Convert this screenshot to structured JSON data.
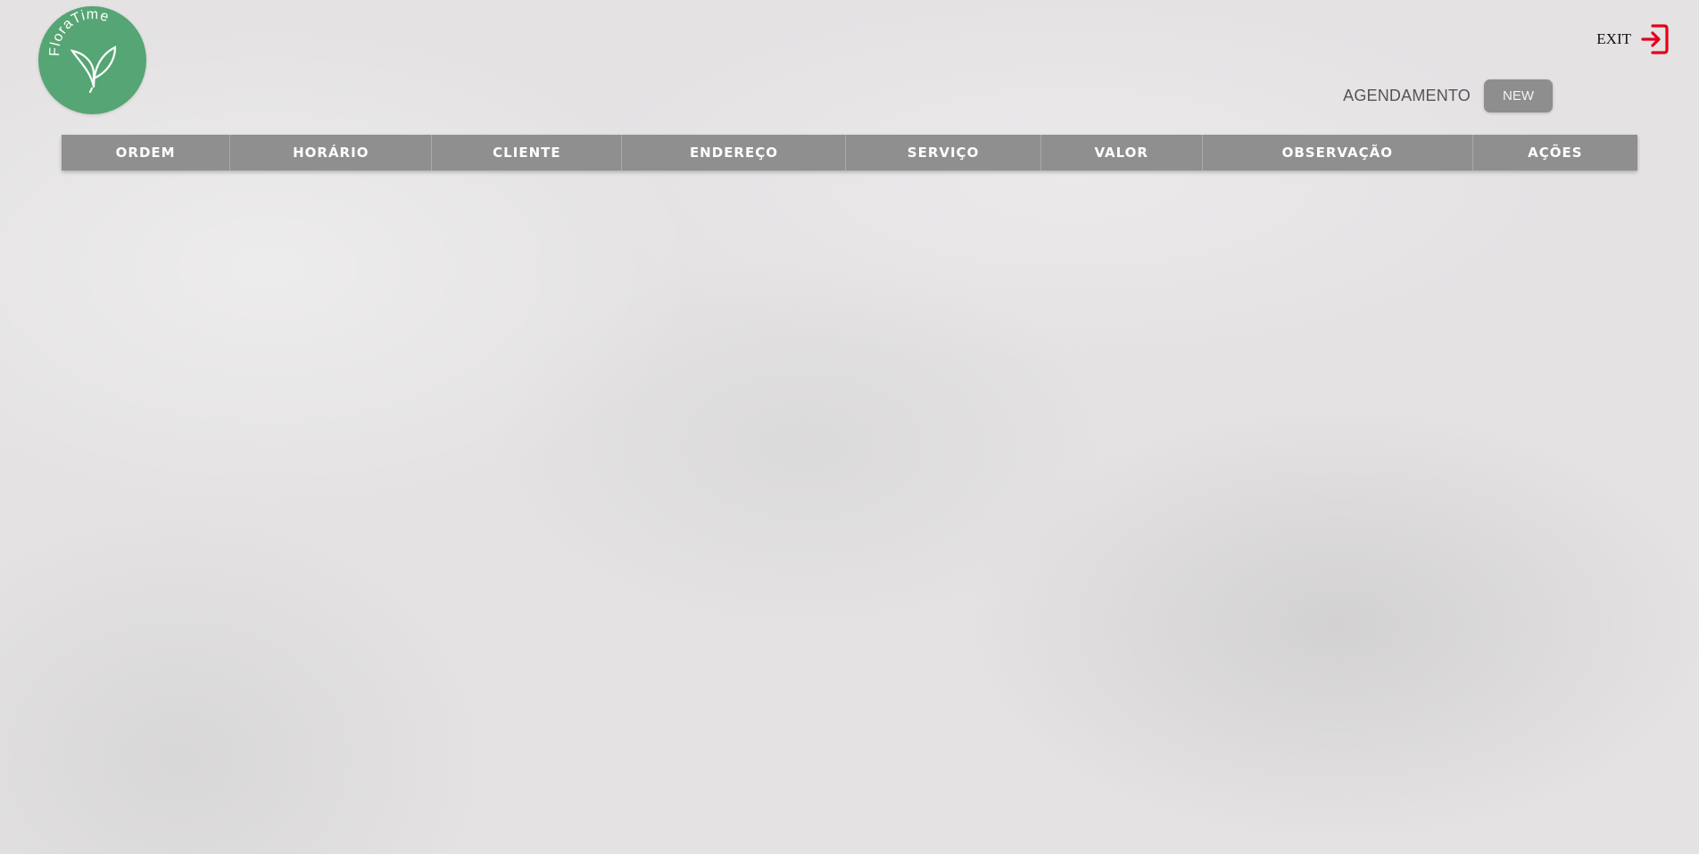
{
  "logo": {
    "text": "FloraTime",
    "color": "#56a574"
  },
  "header": {
    "exit_label": "EXIT",
    "exit_icon": "exit-icon",
    "exit_icon_color": "#e3001b"
  },
  "agenda": {
    "title": "AGENDAMENTO",
    "new_label": "NEW"
  },
  "table": {
    "columns": [
      "ORDEM",
      "HORÁRIO",
      "CLIENTE",
      "ENDEREÇO",
      "SERVIÇO",
      "VALOR",
      "OBSERVAÇÃO",
      "AÇÕES"
    ],
    "rows": []
  }
}
